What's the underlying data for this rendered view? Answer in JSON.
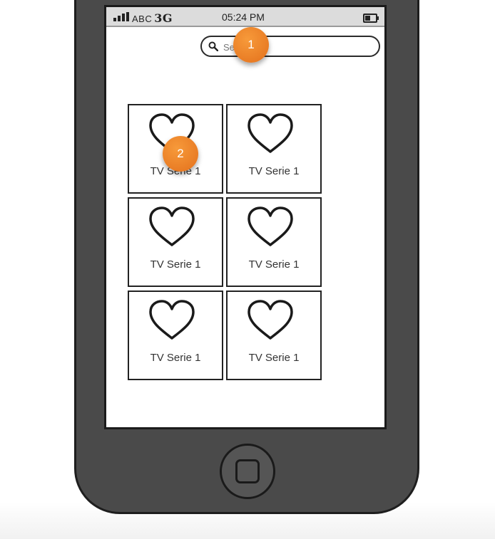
{
  "status_bar": {
    "carrier": "ABC",
    "network": "3G",
    "time": "05:24 PM"
  },
  "search": {
    "placeholder": "Search",
    "icon": "magnifier-icon"
  },
  "grid": {
    "items": [
      {
        "label": "TV Serie 1",
        "icon": "heart-icon"
      },
      {
        "label": "TV Serie 1",
        "icon": "heart-icon"
      },
      {
        "label": "TV Serie 1",
        "icon": "heart-icon"
      },
      {
        "label": "TV Serie 1",
        "icon": "heart-icon"
      },
      {
        "label": "TV Serie 1",
        "icon": "heart-icon"
      },
      {
        "label": "TV Serie 1",
        "icon": "heart-icon"
      }
    ]
  },
  "callouts": [
    "1",
    "2"
  ],
  "colors": {
    "callout": "#ee8327",
    "phone_body": "#4a4a4a",
    "statusbar": "#dcdcdc"
  }
}
